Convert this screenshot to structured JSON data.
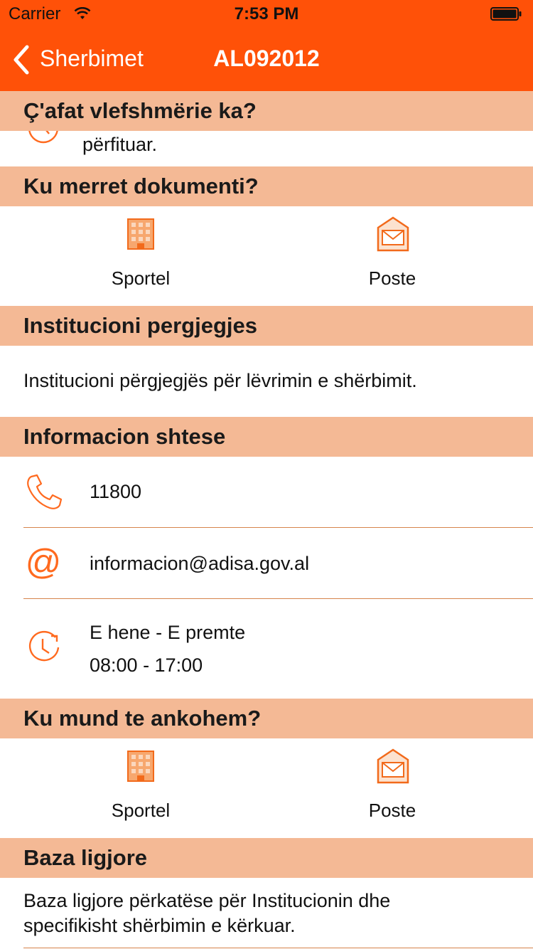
{
  "status_bar": {
    "carrier": "Carrier",
    "time": "7:53 PM"
  },
  "nav": {
    "back_label": "Sherbimet",
    "title": "AL092012"
  },
  "sections": {
    "validity": {
      "title": "Ç'afat vlefshmërie ka?",
      "text": "përfituar."
    },
    "where_get": {
      "title": "Ku merret dokumenti?",
      "items": [
        {
          "label": "Sportel"
        },
        {
          "label": "Poste"
        }
      ]
    },
    "institution": {
      "title": "Institucioni pergjegjes",
      "text": "Institucioni përgjegjës për lëvrimin e shërbimit."
    },
    "info": {
      "title": "Informacion shtese",
      "phone": "11800",
      "email": "informacion@adisa.gov.al",
      "days": "E hene - E premte",
      "hours": "08:00 - 17:00"
    },
    "complaint": {
      "title": "Ku mund te ankohem?",
      "items": [
        {
          "label": "Sportel"
        },
        {
          "label": "Poste"
        }
      ]
    },
    "legal": {
      "title": "Baza ligjore",
      "text_line1": "Baza ligjore përkatëse për Institucionin dhe",
      "text_line2": "specifikisht shërbimin e kërkuar."
    }
  },
  "colors": {
    "accent": "#FF5108",
    "section_bg": "#F4B995",
    "divider": "#D6844C"
  }
}
